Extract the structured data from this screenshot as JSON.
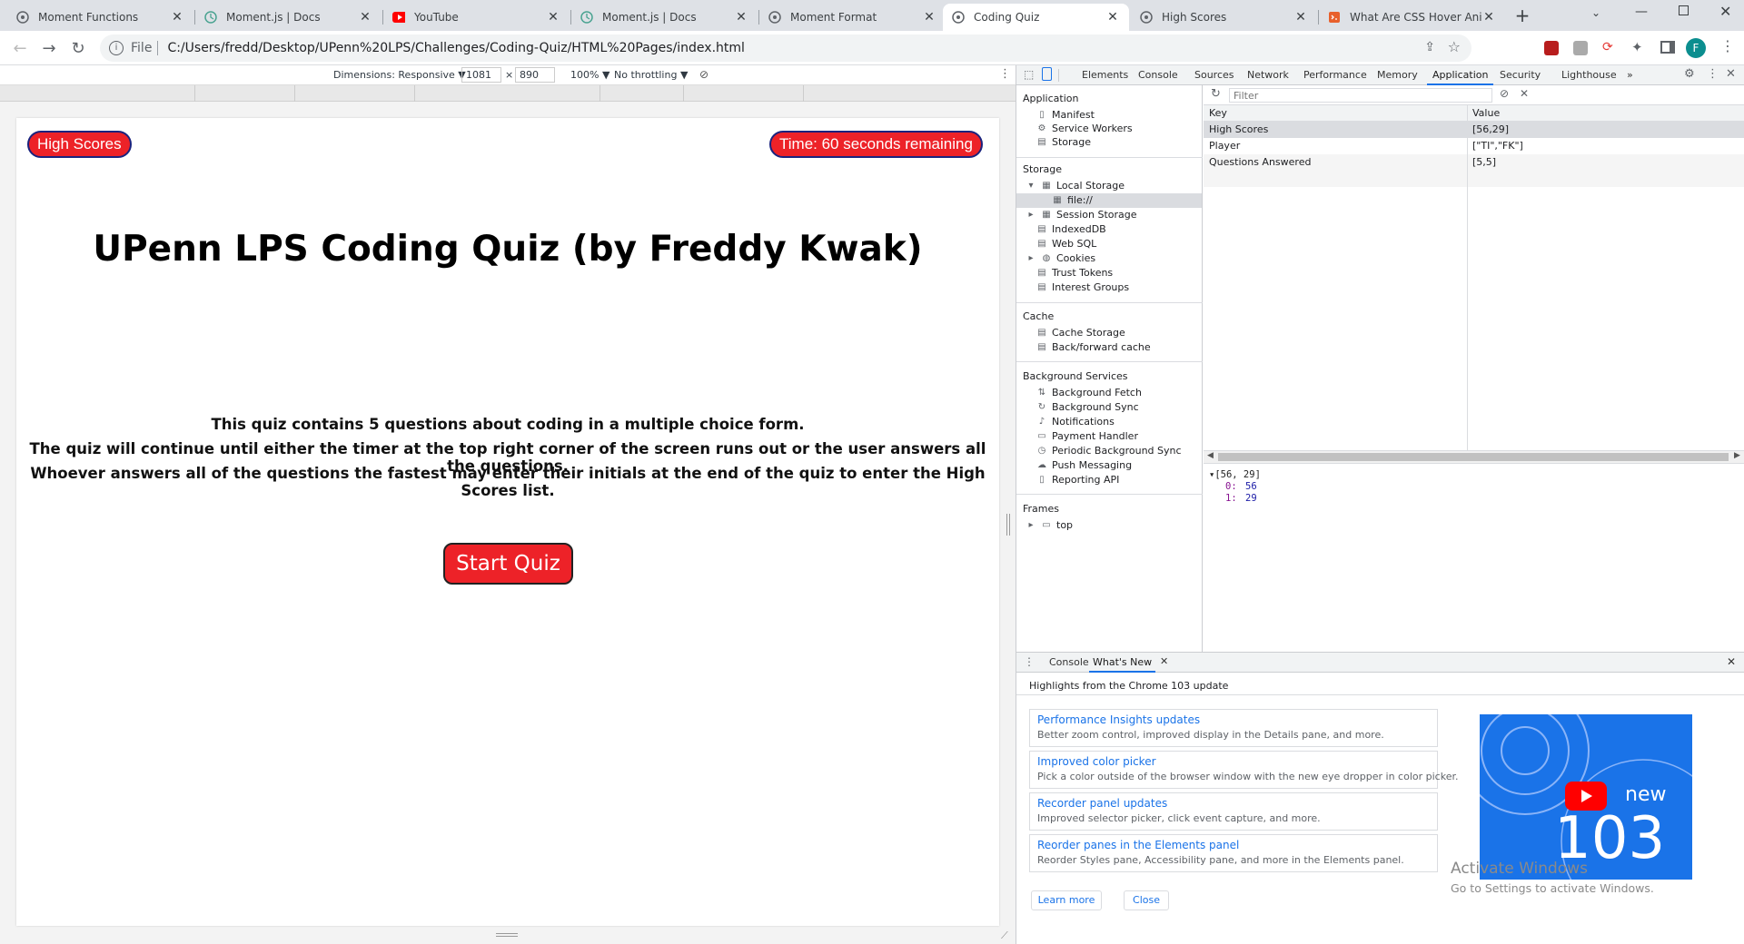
{
  "browser": {
    "tabs": [
      {
        "title": "Moment Functions",
        "icon": "chrome-generic-icon"
      },
      {
        "title": "Moment.js | Docs",
        "icon": "moment-clock-icon"
      },
      {
        "title": "YouTube",
        "icon": "youtube-icon"
      },
      {
        "title": "Moment.js | Docs",
        "icon": "moment-clock-icon"
      },
      {
        "title": "Moment Format",
        "icon": "chrome-generic-icon"
      },
      {
        "title": "Coding Quiz",
        "icon": "chrome-generic-icon"
      },
      {
        "title": "High Scores",
        "icon": "chrome-generic-icon"
      },
      {
        "title": "What Are CSS Hover Anim",
        "icon": "html-icon"
      }
    ],
    "active_tab_index": 5,
    "new_tab_symbol": "+",
    "address_scheme": "File",
    "address": "C:/Users/fredd/Desktop/UPenn%20LPS/Challenges/Coding-Quiz/HTML%20Pages/index.html",
    "profile_initial": "F"
  },
  "device_toolbar": {
    "dimensions_label": "Dimensions: Responsive ▼",
    "width": "1081",
    "times": "×",
    "height": "890",
    "zoom": "100% ▼",
    "throttling": "No throttling ▼"
  },
  "page": {
    "high_scores_label": "High Scores",
    "timer_label": "Time: 60 seconds remaining",
    "title": "UPenn LPS Coding Quiz (by Freddy Kwak)",
    "intro_lines": [
      "This quiz contains 5 questions about coding in a multiple choice form.",
      "The quiz will continue until either the timer at the top right corner of the screen runs out or the user answers all the questions.",
      "Whoever answers all of the questions the fastest may enter their initials at the end of the quiz to enter the High Scores list."
    ],
    "start_label": "Start Quiz",
    "accent_color": "#ed2228"
  },
  "devtools": {
    "tabs": [
      "Elements",
      "Console",
      "Sources",
      "Network",
      "Performance",
      "Memory",
      "Application",
      "Security",
      "Lighthouse",
      "»"
    ],
    "active_tab": "Application",
    "sidebar": {
      "application_title": "Application",
      "application_items": [
        "Manifest",
        "Service Workers",
        "Storage"
      ],
      "storage_title": "Storage",
      "storage_items": [
        "Local Storage",
        "file://",
        "Session Storage",
        "IndexedDB",
        "Web SQL",
        "Cookies",
        "Trust Tokens",
        "Interest Groups"
      ],
      "cache_title": "Cache",
      "cache_items": [
        "Cache Storage",
        "Back/forward cache"
      ],
      "bg_title": "Background Services",
      "bg_items": [
        "Background Fetch",
        "Background Sync",
        "Notifications",
        "Payment Handler",
        "Periodic Background Sync",
        "Push Messaging",
        "Reporting API"
      ],
      "frames_title": "Frames",
      "frames_items": [
        "top"
      ]
    },
    "filter_placeholder": "Filter",
    "table": {
      "key_header": "Key",
      "value_header": "Value",
      "rows": [
        {
          "key": "High Scores",
          "value": "[56,29]"
        },
        {
          "key": "Player",
          "value": "[\"TI\",\"FK\"]"
        },
        {
          "key": "Questions Answered",
          "value": "[5,5]"
        }
      ]
    },
    "preview": {
      "summary": "▾[56, 29]",
      "items": [
        {
          "index": "0:",
          "value": "56"
        },
        {
          "index": "1:",
          "value": "29"
        }
      ]
    },
    "drawer": {
      "tabs": [
        "Console",
        "What's New"
      ],
      "active_tab": "What's New",
      "heading": "Highlights from the Chrome 103 update",
      "cards": [
        {
          "title": "Performance Insights updates",
          "desc": "Better zoom control, improved display in the Details pane, and more."
        },
        {
          "title": "Improved color picker",
          "desc": "Pick a color outside of the browser window with the new eye dropper in color picker."
        },
        {
          "title": "Recorder panel updates",
          "desc": "Improved selector picker, click event capture, and more."
        },
        {
          "title": "Reorder panes in the Elements panel",
          "desc": "Reorder Styles pane, Accessibility pane, and more in the Elements panel."
        }
      ],
      "learn_more": "Learn more",
      "close": "Close",
      "promo_word": "new",
      "promo_number": "103"
    }
  },
  "watermark": {
    "line1": "Activate Windows",
    "line2": "Go to Settings to activate Windows."
  }
}
